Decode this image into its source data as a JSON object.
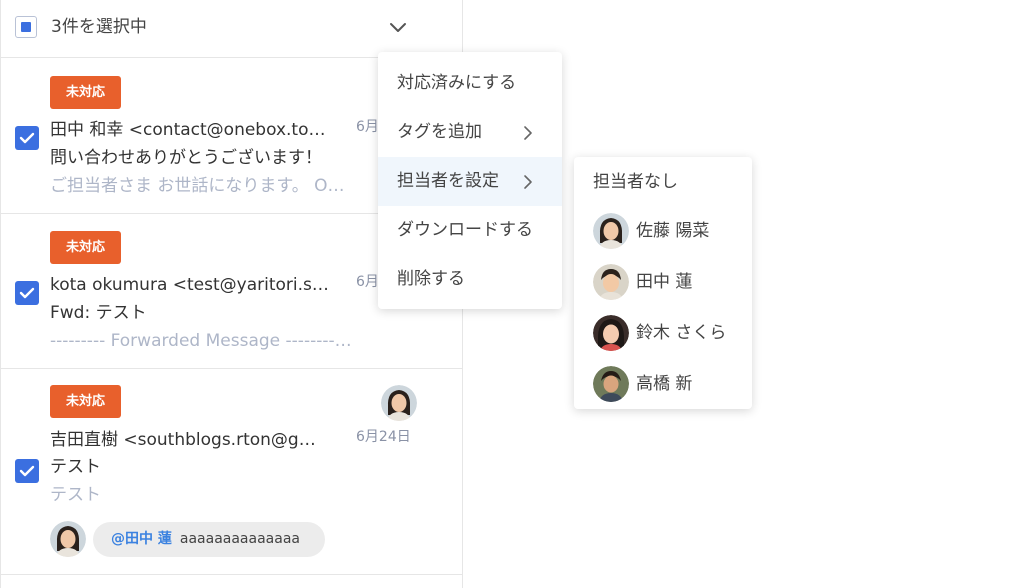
{
  "header": {
    "selection_text": "3件を選択中"
  },
  "messages": [
    {
      "badge": "未対応",
      "from": "田中 和幸 <contact@onebox.to…",
      "date": "6月",
      "subject": "問い合わせありがとうございます！",
      "preview": "ご担当者さま お世話になります。 O…",
      "checked": true
    },
    {
      "badge": "未対応",
      "from": "kota okumura <test@yaritori.s…",
      "date": "6月",
      "subject": "Fwd: テスト",
      "preview": "--------- Forwarded Message --------…",
      "checked": true
    },
    {
      "badge": "未対応",
      "from": "吉田直樹 <southblogs.rton@g…",
      "date": "6月24日",
      "subject": "テスト",
      "preview": "テスト",
      "checked": true,
      "mention": {
        "who": "@田中 蓮",
        "text": "aaaaaaaaaaaaaa"
      }
    }
  ],
  "context_menu": {
    "items": [
      {
        "label": "対応済みにする",
        "has_submenu": false
      },
      {
        "label": "タグを追加",
        "has_submenu": true
      },
      {
        "label": "担当者を設定",
        "has_submenu": true,
        "active": true
      },
      {
        "label": "ダウンロードする",
        "has_submenu": false
      },
      {
        "label": "削除する",
        "has_submenu": false
      }
    ]
  },
  "assignee_menu": {
    "items": [
      {
        "label": "担当者なし"
      },
      {
        "label": "佐藤 陽菜"
      },
      {
        "label": "田中 蓮"
      },
      {
        "label": "鈴木 さくら"
      },
      {
        "label": "高橋 新"
      }
    ]
  },
  "colors": {
    "accent": "#3b6fe0",
    "badge": "#e8602c",
    "mention_name": "#3b82e0",
    "menu_hover": "#f0f6fc"
  }
}
